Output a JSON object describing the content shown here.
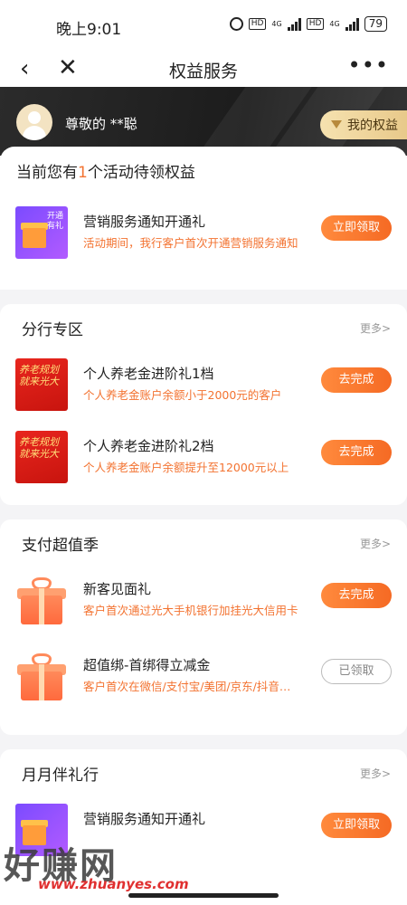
{
  "status": {
    "time": "晚上9:01",
    "battery": "79",
    "net1": "4G",
    "net2": "4G",
    "hd": "HD"
  },
  "nav": {
    "title": "权益服务"
  },
  "banner": {
    "greeting": "尊敬的 **聪",
    "rights_button": "我的权益"
  },
  "pending": {
    "prefix": "当前您有",
    "count": "1",
    "suffix": "个活动待领权益",
    "items": [
      {
        "name": "营销服务通知开通礼",
        "desc": "活动期间，我行客户首次开通营销服务通知",
        "button": "立即领取",
        "thumb_text": "开通有礼"
      }
    ]
  },
  "branch": {
    "title": "分行专区",
    "more": "更多>",
    "items": [
      {
        "name": "个人养老金进阶礼1档",
        "desc": "个人养老金账户余额小于2000元的客户",
        "button": "去完成",
        "thumb_big": "养老规划 就来光大"
      },
      {
        "name": "个人养老金进阶礼2档",
        "desc": "个人养老金账户余额提升至12000元以上",
        "button": "去完成",
        "thumb_big": "养老规划 就来光大"
      }
    ]
  },
  "payment": {
    "title": "支付超值季",
    "more": "更多>",
    "items": [
      {
        "name": "新客见面礼",
        "desc": "客户首次通过光大手机银行加挂光大信用卡",
        "button": "去完成"
      },
      {
        "name": "超值绑-首绑得立减金",
        "desc": "客户首次在微信/支付宝/美团/京东/抖音绑卡",
        "button": "已领取"
      }
    ]
  },
  "monthly": {
    "title": "月月伴礼行",
    "more": "更多>",
    "items": [
      {
        "name": "营销服务通知开通礼",
        "button": "立即领取"
      }
    ]
  },
  "watermark": {
    "text": "好赚网",
    "url": "www.zhuanyes.com"
  }
}
